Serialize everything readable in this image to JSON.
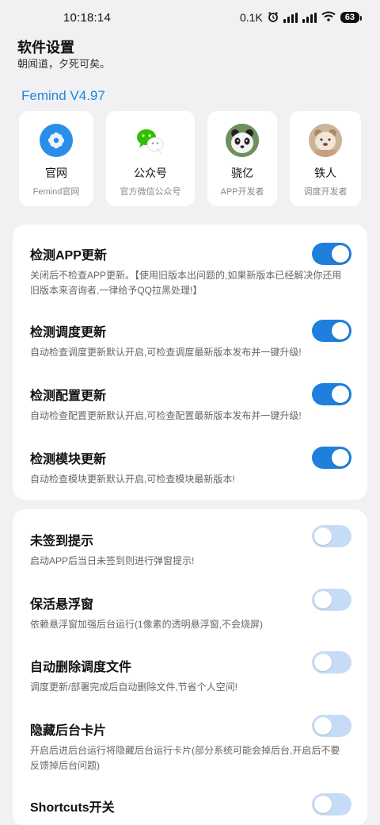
{
  "status_bar": {
    "time": "10:18:14",
    "net_speed": "0.1K",
    "battery": "63"
  },
  "header": {
    "title": "软件设置",
    "subtitle": "朝闻道，夕死可矣。"
  },
  "version": "Femind V4.97",
  "cards": [
    {
      "label": "官网",
      "desc": "Femind官网",
      "icon": "flower-icon"
    },
    {
      "label": "公众号",
      "desc": "官方微信公众号",
      "icon": "wechat-icon"
    },
    {
      "label": "骁亿",
      "desc": "APP开发者",
      "icon": "panda-avatar"
    },
    {
      "label": "铁人",
      "desc": "调度开发者",
      "icon": "teddy-avatar"
    }
  ],
  "update_settings": [
    {
      "title": "检测APP更新",
      "desc": "关闭后不检查APP更新。【使用旧版本出问题的,如果新版本已经解决你还用旧版本来咨询者,一律给予QQ拉黑处理!】",
      "enabled": true
    },
    {
      "title": "检测调度更新",
      "desc": "自动检查调度更新默认开启,可检查调度最新版本发布并一键升级!",
      "enabled": true
    },
    {
      "title": "检测配置更新",
      "desc": "自动检查配置更新默认开启,可检查配置最新版本发布并一键升级!",
      "enabled": true
    },
    {
      "title": "检测模块更新",
      "desc": "自动检查模块更新默认开启,可检查模块最新版本!",
      "enabled": true
    }
  ],
  "other_settings": [
    {
      "title": "未签到提示",
      "desc": "启动APP后当日未签到则进行弹窗提示!",
      "enabled": false
    },
    {
      "title": "保活悬浮窗",
      "desc": "依赖悬浮窗加强后台运行(1像素的透明悬浮窗,不会烧屏)",
      "enabled": false
    },
    {
      "title": "自动删除调度文件",
      "desc": "调度更新/部署完成后自动删除文件,节省个人空间!",
      "enabled": false
    },
    {
      "title": "隐藏后台卡片",
      "desc": "开启后进后台运行将隐藏后台运行卡片(部分系统可能会掉后台,开启后不要反馈掉后台问题)",
      "enabled": false
    },
    {
      "title": "Shortcuts开关",
      "desc": "",
      "enabled": false
    }
  ],
  "colors": {
    "accent": "#1e7fdc",
    "toggle_off": "#c6dcf6",
    "version_text": "#1e88d8",
    "background": "#f1f1f3"
  }
}
